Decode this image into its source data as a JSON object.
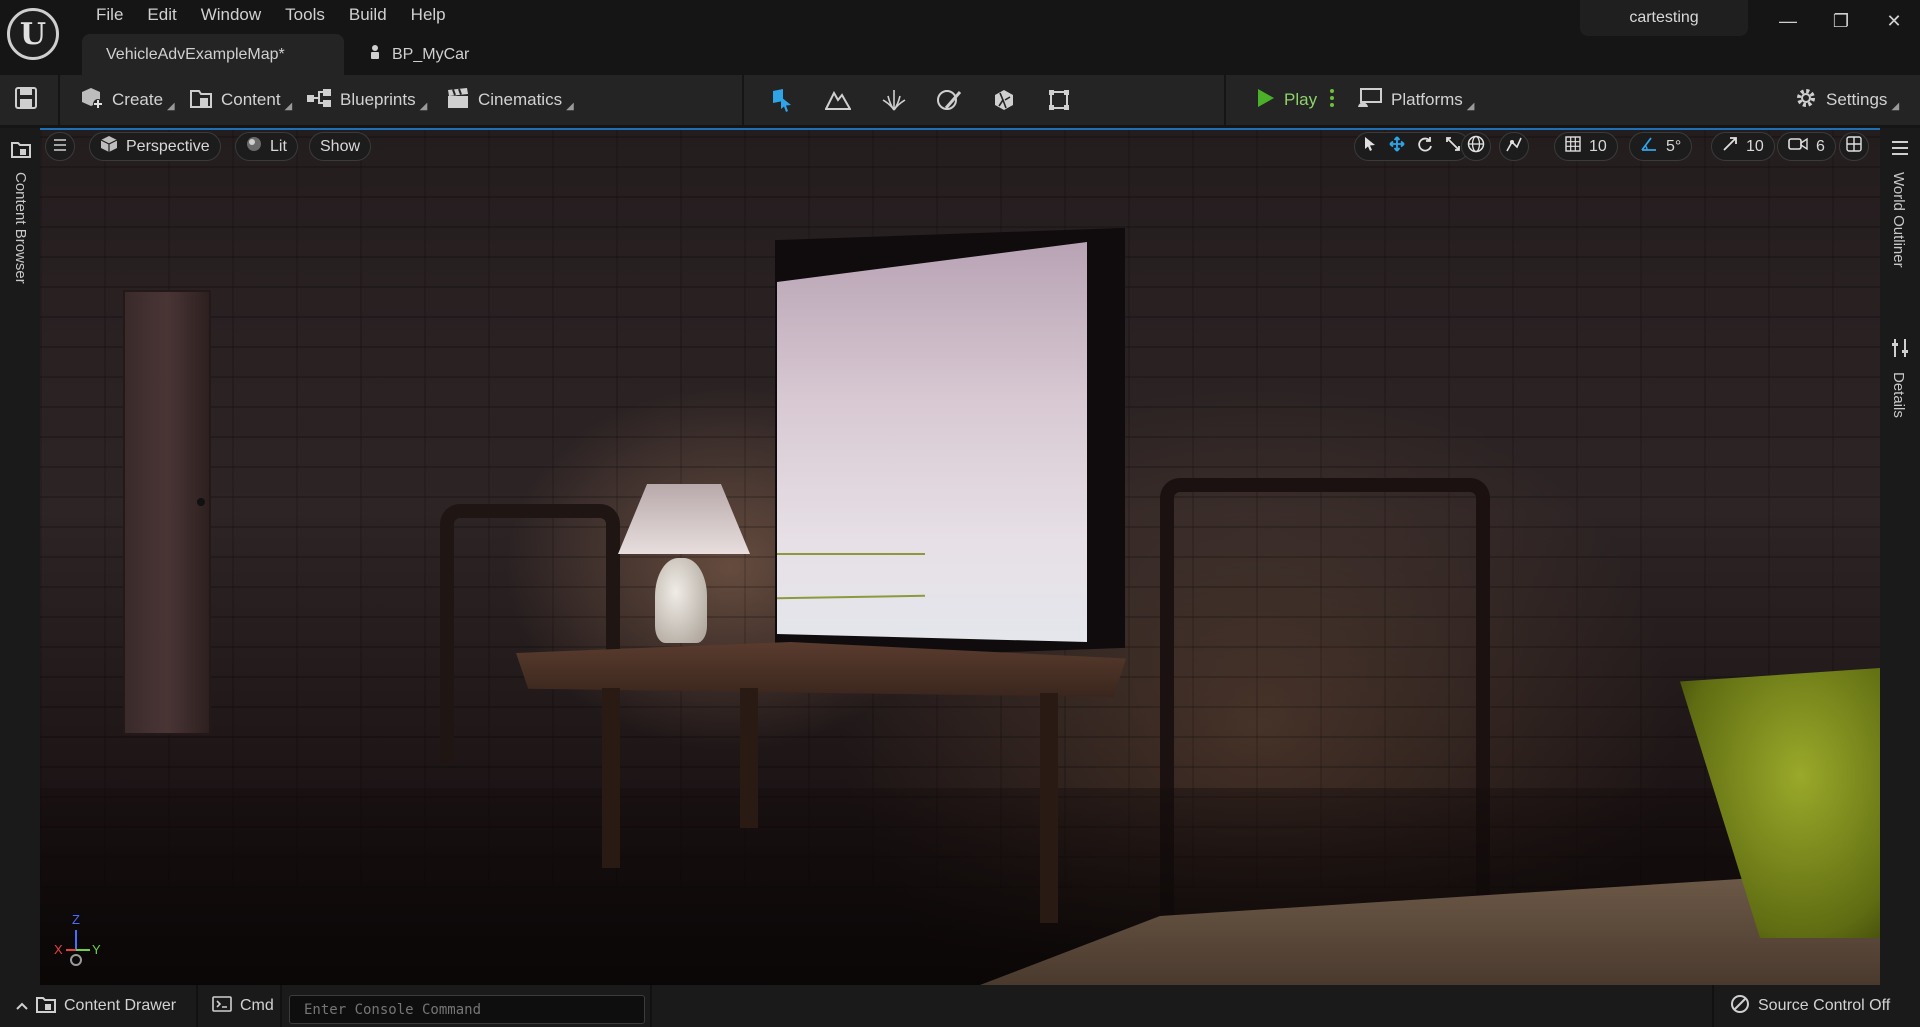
{
  "app": {
    "logo": "U",
    "project_name": "cartesting"
  },
  "menu": [
    "File",
    "Edit",
    "Window",
    "Tools",
    "Build",
    "Help"
  ],
  "tabs": [
    {
      "label": "VehicleAdvExampleMap*",
      "active": true
    },
    {
      "label": "BP_MyCar",
      "active": false
    }
  ],
  "window_controls": {
    "minimize": "—",
    "restore": "❐",
    "close": "✕"
  },
  "toolbar": {
    "create": "Create",
    "content": "Content",
    "blueprints": "Blueprints",
    "cinematics": "Cinematics",
    "play": "Play",
    "platforms": "Platforms",
    "settings": "Settings",
    "modes": [
      "select-mode-icon",
      "landscape-mode-icon",
      "foliage-mode-icon",
      "mesh-paint-mode-icon",
      "fracture-mode-icon",
      "modeling-mode-icon"
    ]
  },
  "side_panels": {
    "left": "Content Browser",
    "right_top": "World Outliner",
    "right_bottom": "Details"
  },
  "viewport": {
    "perspective": "Perspective",
    "lit": "Lit",
    "show": "Show",
    "grid_snap": "10",
    "rotation_snap": "5°",
    "scale_snap": "10",
    "camera_speed": "6",
    "axes": {
      "x": "X",
      "y": "Y",
      "z": "Z"
    }
  },
  "statusbar": {
    "content_drawer": "Content Drawer",
    "cmd": "Cmd",
    "console_placeholder": "Enter Console Command",
    "source_control": "Source Control Off"
  },
  "colors": {
    "accent_blue": "#1e6fb5",
    "play_green": "#4caf2a",
    "mode_active": "#2fa4e7"
  }
}
